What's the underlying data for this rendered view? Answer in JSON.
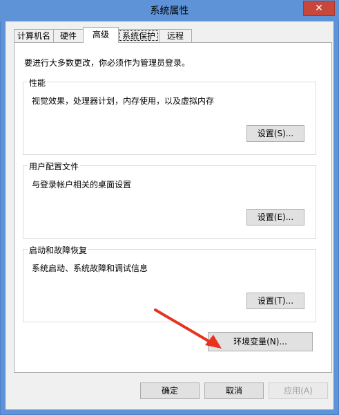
{
  "window": {
    "title": "系统属性",
    "close_label": "✕"
  },
  "tabs": [
    {
      "label": "计算机名"
    },
    {
      "label": "硬件"
    },
    {
      "label": "高级"
    },
    {
      "label": "系统保护"
    },
    {
      "label": "远程"
    }
  ],
  "advanced": {
    "admin_note": "要进行大多数更改，你必须作为管理员登录。",
    "performance": {
      "legend": "性能",
      "desc": "视觉效果，处理器计划，内存使用，以及虚拟内存",
      "button": "设置(S)..."
    },
    "user_profiles": {
      "legend": "用户配置文件",
      "desc": "与登录帐户相关的桌面设置",
      "button": "设置(E)..."
    },
    "startup_recovery": {
      "legend": "启动和故障恢复",
      "desc": "系统启动、系统故障和调试信息",
      "button": "设置(T)..."
    },
    "env_button": "环境变量(N)..."
  },
  "footer": {
    "ok": "确定",
    "cancel": "取消",
    "apply": "应用(A)"
  },
  "colors": {
    "titlebar": "#5e93d8",
    "close": "#c7473b",
    "arrow": "#e8321e"
  }
}
